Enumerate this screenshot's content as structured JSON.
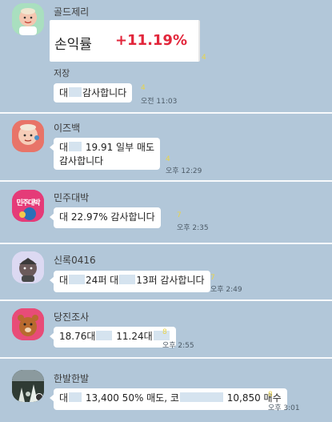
{
  "messages": [
    {
      "sender": "골드제리",
      "card": {
        "label": "손익률",
        "value": "+11.19%",
        "value_color": "#e2263b"
      },
      "card_count": "4",
      "caption": "저장",
      "text_before": "대",
      "text_after": "감사합니다",
      "count": "4",
      "time": "오전 11:03"
    },
    {
      "sender": "이즈백",
      "line1_before": "대",
      "line1_after": "19.91  일부 매도",
      "line2": "감사합니다",
      "count": "4",
      "time": "오후 12:29"
    },
    {
      "sender": "민주대박",
      "avatar_text": "민주대박",
      "text": "대 22.97% 감사합니다",
      "count": "7",
      "time": "오후 2:35"
    },
    {
      "sender": "신록0416",
      "part1": "대",
      "part2": "24퍼 대",
      "part3": "13퍼 감사합니다",
      "count": "7",
      "time": "오후 2:49"
    },
    {
      "sender": "당진조사",
      "part1": "18.76대",
      "part2": "11.24대",
      "count": "8",
      "time": "오후 2:55"
    },
    {
      "sender": "한발한발",
      "part1": "대",
      "part2": "13,400 50% 매도, 코",
      "part3": "10,850 매수",
      "count": "8",
      "time": "오후 3:01"
    }
  ]
}
